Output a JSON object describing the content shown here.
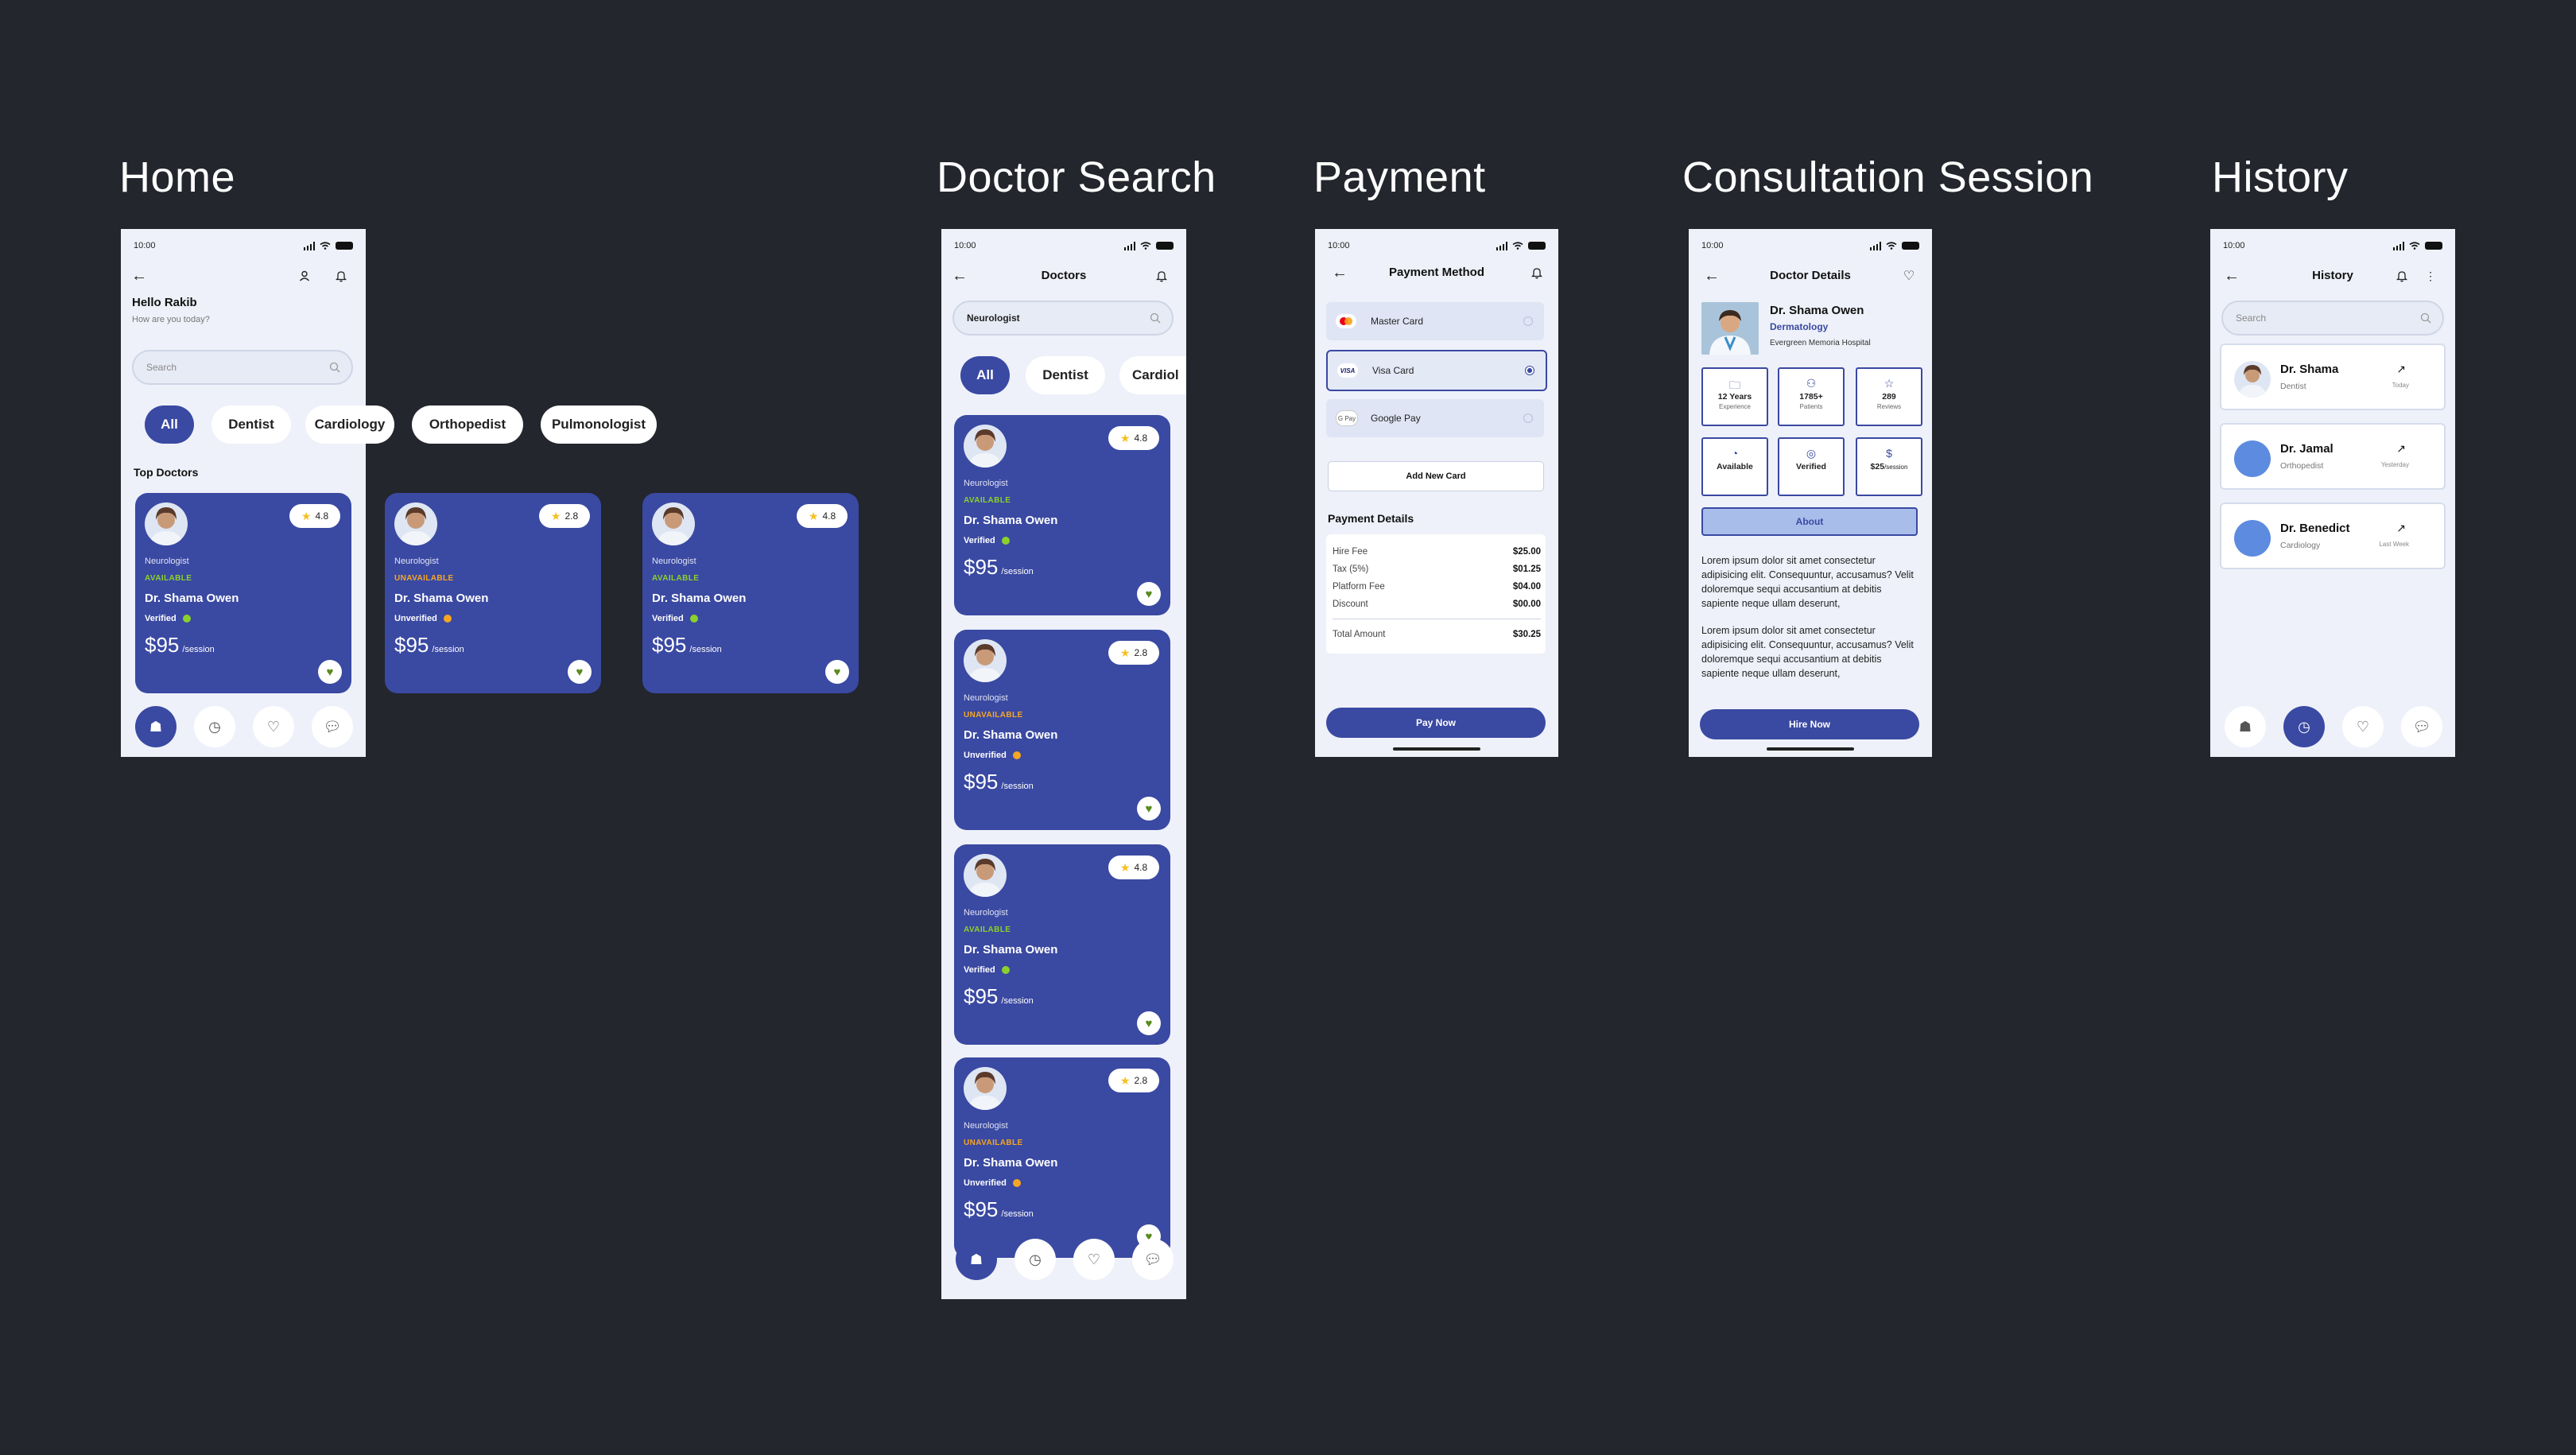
{
  "colors": {
    "background": "#23262d",
    "primary": "#3a49a2",
    "available": "#8bd12c",
    "unavailable": "#f6a623",
    "screen": "#eef1f9"
  },
  "status_bar": {
    "time": "10:00"
  },
  "home": {
    "section_title": "Home",
    "greeting": "Hello Rakib",
    "subtitle": "How are you today?",
    "search_placeholder": "Search",
    "chips": [
      "All",
      "Dentist",
      "Cardiology",
      "Orthopedist",
      "Pulmonologist"
    ],
    "top_doctors_title": "Top Doctors",
    "cards": [
      {
        "rating": "4.8",
        "specialty": "Neurologist",
        "status": "AVAILABLE",
        "name": "Dr. Shama Owen",
        "verification": "Verified",
        "price": "$95",
        "per": "/session"
      },
      {
        "rating": "2.8",
        "specialty": "Neurologist",
        "status": "UNAVAILABLE",
        "name": "Dr. Shama Owen",
        "verification": "Unverified",
        "price": "$95",
        "per": "/session"
      },
      {
        "rating": "4.8",
        "specialty": "Neurologist",
        "status": "AVAILABLE",
        "name": "Dr. Shama Owen",
        "verification": "Verified",
        "price": "$95",
        "per": "/session"
      }
    ],
    "tabs": [
      "home-icon",
      "history-icon",
      "heart-icon",
      "chat-icon"
    ]
  },
  "search": {
    "section_title": "Doctor Search",
    "header_title": "Doctors",
    "search_value": "Neurologist",
    "chips": [
      "All",
      "Dentist",
      "Cardiol"
    ],
    "cards": [
      {
        "rating": "4.8",
        "specialty": "Neurologist",
        "status": "AVAILABLE",
        "name": "Dr. Shama Owen",
        "verification": "Verified",
        "price": "$95",
        "per": "/session"
      },
      {
        "rating": "2.8",
        "specialty": "Neurologist",
        "status": "UNAVAILABLE",
        "name": "Dr. Shama Owen",
        "verification": "Unverified",
        "price": "$95",
        "per": "/session"
      },
      {
        "rating": "4.8",
        "specialty": "Neurologist",
        "status": "AVAILABLE",
        "name": "Dr. Shama Owen",
        "verification": "Verified",
        "price": "$95",
        "per": "/session"
      },
      {
        "rating": "2.8",
        "specialty": "Neurologist",
        "status": "UNAVAILABLE",
        "name": "Dr. Shama Owen",
        "verification": "Unverified",
        "price": "$95",
        "per": "/session"
      }
    ]
  },
  "payment": {
    "section_title": "Payment",
    "header_title": "Payment Method",
    "methods": [
      {
        "label": "Master Card",
        "selected": false
      },
      {
        "label": "Visa Card",
        "selected": true
      },
      {
        "label": "Google Pay",
        "selected": false
      }
    ],
    "add_card": "Add New Card",
    "details_title": "Payment Details",
    "lines": [
      {
        "label": "Hire Fee",
        "value": "$25.00"
      },
      {
        "label": "Tax (5%)",
        "value": "$01.25"
      },
      {
        "label": "Platform Fee",
        "value": "$04.00"
      },
      {
        "label": "Discount",
        "value": "$00.00"
      }
    ],
    "total_label": "Total Amount",
    "total_value": "$30.25",
    "pay_button": "Pay Now"
  },
  "consult": {
    "section_title": "Consultation Session",
    "header_title": "Doctor Details",
    "doctor_name": "Dr. Shama Owen",
    "doctor_specialty": "Dermatology",
    "hospital": "Evergreen Memoria Hospital",
    "stats": [
      {
        "icon": "briefcase-icon",
        "value": "12 Years",
        "label": "Experience"
      },
      {
        "icon": "users-icon",
        "value": "1785+",
        "label": "Patients"
      },
      {
        "icon": "star-icon",
        "value": "289",
        "label": "Reviews"
      },
      {
        "icon": "badge-icon",
        "value": "Available",
        "label": ""
      },
      {
        "icon": "check-circle-icon",
        "value": "Verified",
        "label": ""
      },
      {
        "icon": "dollar-icon",
        "value": "$25",
        "label": "/session"
      }
    ],
    "about_tab": "About",
    "paragraph1": "Lorem ipsum dolor sit amet consectetur adipisicing elit. Consequuntur, accusamus? Velit doloremque sequi accusantium at debitis sapiente neque ullam deserunt,",
    "paragraph2": "Lorem ipsum dolor sit amet consectetur adipisicing elit. Consequuntur, accusamus? Velit doloremque sequi accusantium at debitis sapiente neque ullam deserunt,",
    "hire_button": "Hire Now"
  },
  "history": {
    "section_title": "History",
    "header_title": "History",
    "search_placeholder": "Search",
    "items": [
      {
        "name": "Dr. Shama",
        "specialty": "Dentist",
        "time": "Today"
      },
      {
        "name": "Dr. Jamal",
        "specialty": "Orthopedist",
        "time": "Yesterday"
      },
      {
        "name": "Dr. Benedict",
        "specialty": "Cardiology",
        "time": "Last Week"
      }
    ]
  }
}
